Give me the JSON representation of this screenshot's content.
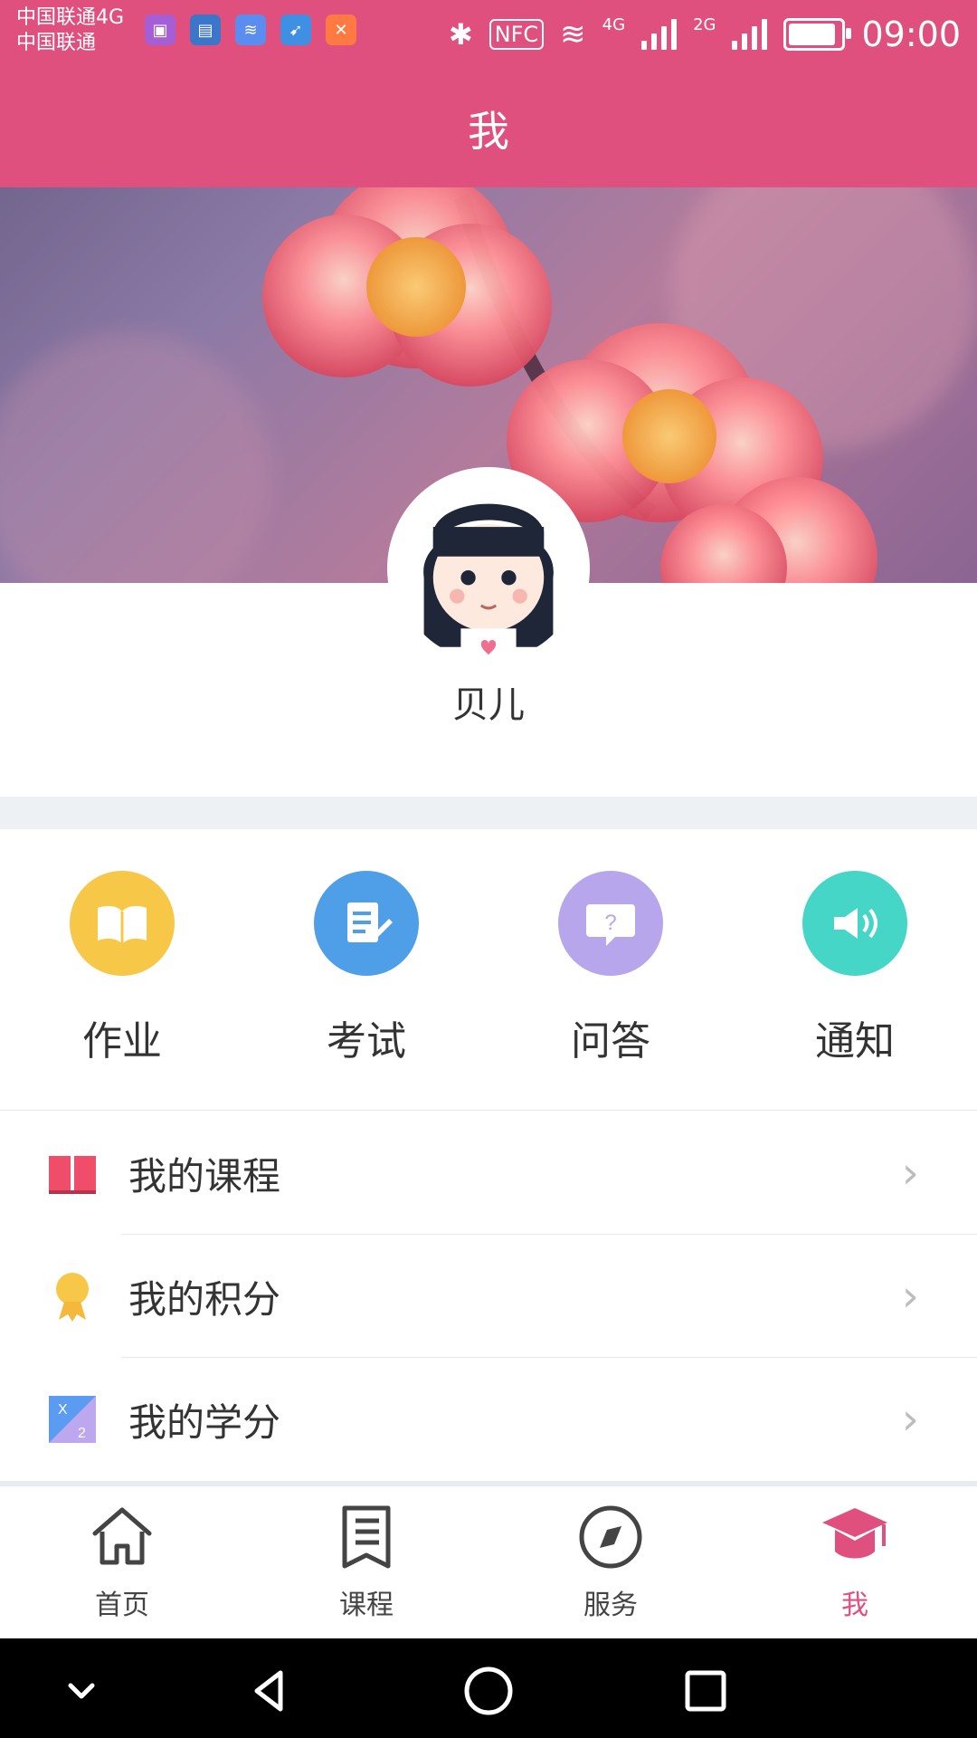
{
  "status_bar": {
    "carrier_top": "中国联通4G",
    "carrier_bottom": "中国联通",
    "net1": "4G",
    "net2": "2G",
    "nfc": "NFC",
    "time": "09:00",
    "battery_level": 0.9
  },
  "header": {
    "title": "我"
  },
  "profile": {
    "name": "贝儿"
  },
  "quick_actions": [
    {
      "label": "作业",
      "icon": "book-icon",
      "color": "#f7c748"
    },
    {
      "label": "考试",
      "icon": "exam-icon",
      "color": "#4e9ee8"
    },
    {
      "label": "问答",
      "icon": "question-icon",
      "color": "#b7a6eb"
    },
    {
      "label": "通知",
      "icon": "speaker-icon",
      "color": "#45d6c7"
    }
  ],
  "list": [
    {
      "label": "我的课程",
      "icon": "course-book-icon"
    },
    {
      "label": "我的积分",
      "icon": "medal-icon"
    },
    {
      "label": "我的学分",
      "icon": "math-icon"
    }
  ],
  "bottom_nav": {
    "tabs": [
      {
        "label": "首页",
        "icon": "home-icon"
      },
      {
        "label": "课程",
        "icon": "list-icon"
      },
      {
        "label": "服务",
        "icon": "compass-icon"
      },
      {
        "label": "我",
        "icon": "graduation-cap-icon",
        "active": true
      }
    ]
  },
  "colors": {
    "accent": "#e0507e"
  }
}
